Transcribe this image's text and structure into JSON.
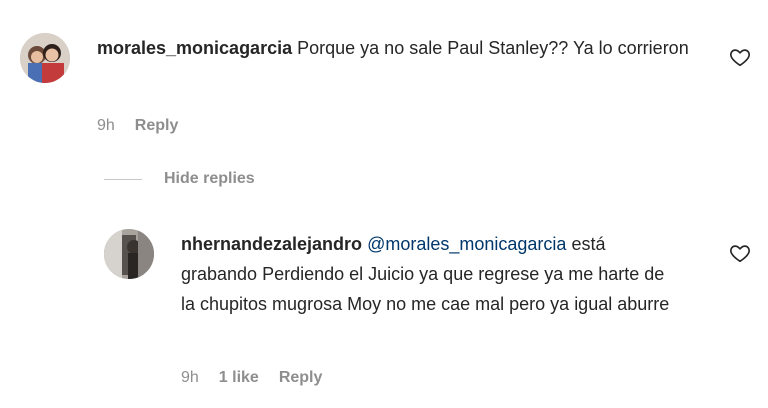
{
  "comment1": {
    "username": "morales_monicagarcia",
    "text": "Porque ya no sale Paul Stanley?? Ya lo corrieron",
    "time": "9h",
    "reply_label": "Reply"
  },
  "hide_replies_label": "Hide replies",
  "reply1": {
    "username": "nhernandezalejandro",
    "mention": "@morales_monicagarcia",
    "text": "está grabando Perdiendo el Juicio ya que regrese ya me harte de la chupitos mugrosa Moy no me cae mal pero ya igual aburre",
    "time": "9h",
    "likes": "1 like",
    "reply_label": "Reply"
  },
  "icons": {
    "like": "heart-outline-icon"
  }
}
